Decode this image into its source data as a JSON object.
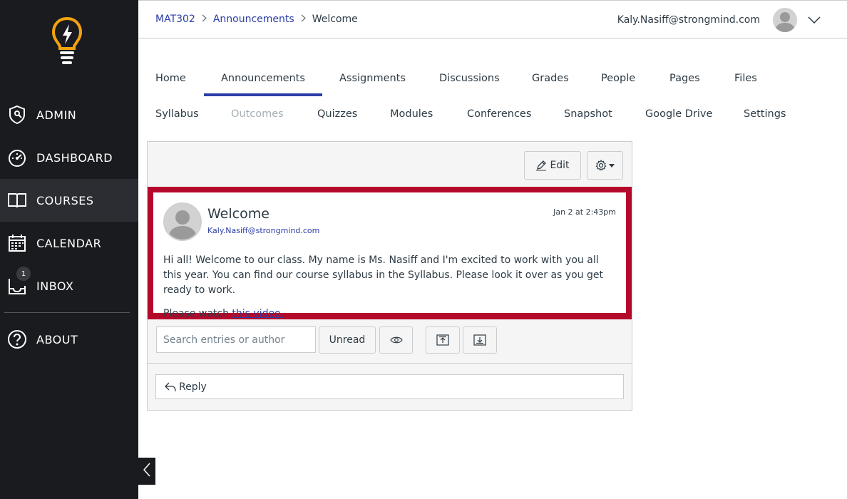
{
  "sidebar": {
    "logo_icon": "lightbulb-bolt-icon",
    "items": [
      {
        "label": "ADMIN",
        "icon": "admin-shield-icon"
      },
      {
        "label": "DASHBOARD",
        "icon": "dashboard-gauge-icon"
      },
      {
        "label": "COURSES",
        "icon": "courses-book-icon"
      },
      {
        "label": "CALENDAR",
        "icon": "calendar-icon"
      },
      {
        "label": "INBOX",
        "icon": "inbox-icon",
        "badge": "1"
      }
    ],
    "about": {
      "label": "ABOUT",
      "icon": "help-circle-icon"
    }
  },
  "header": {
    "breadcrumb": [
      "MAT302",
      "Announcements",
      "Welcome"
    ],
    "user_email": "Kaly.Nasiff@strongmind.com"
  },
  "tabs": {
    "row1": [
      "Home",
      "Announcements",
      "Assignments",
      "Discussions",
      "Grades",
      "People",
      "Pages",
      "Files"
    ],
    "row2": [
      "Syllabus",
      "Outcomes",
      "Quizzes",
      "Modules",
      "Conferences",
      "Snapshot",
      "Google Drive",
      "Settings"
    ]
  },
  "toolbar": {
    "edit_label": "Edit"
  },
  "post": {
    "title": "Welcome",
    "author": "Kaly.Nasiff@strongmind.com",
    "date": "Jan 2 at 2:43pm",
    "body_line1": "Hi all! Welcome to our class. My name is Ms. Nasiff and I'm excited to work with you all this year. You can find our course syllabus in the Syllabus. Please look it over as you get ready to work.",
    "body_line2_prefix": "Please watch ",
    "body_line2_link": "this video."
  },
  "filters": {
    "search_placeholder": "Search entries or author",
    "unread_label": "Unread"
  },
  "reply": {
    "label": "Reply"
  },
  "colors": {
    "sidebar_bg": "#1a1b1f",
    "accent": "#2b3ea6",
    "highlight_border": "#b5092b",
    "logo": "#f2a30f"
  }
}
